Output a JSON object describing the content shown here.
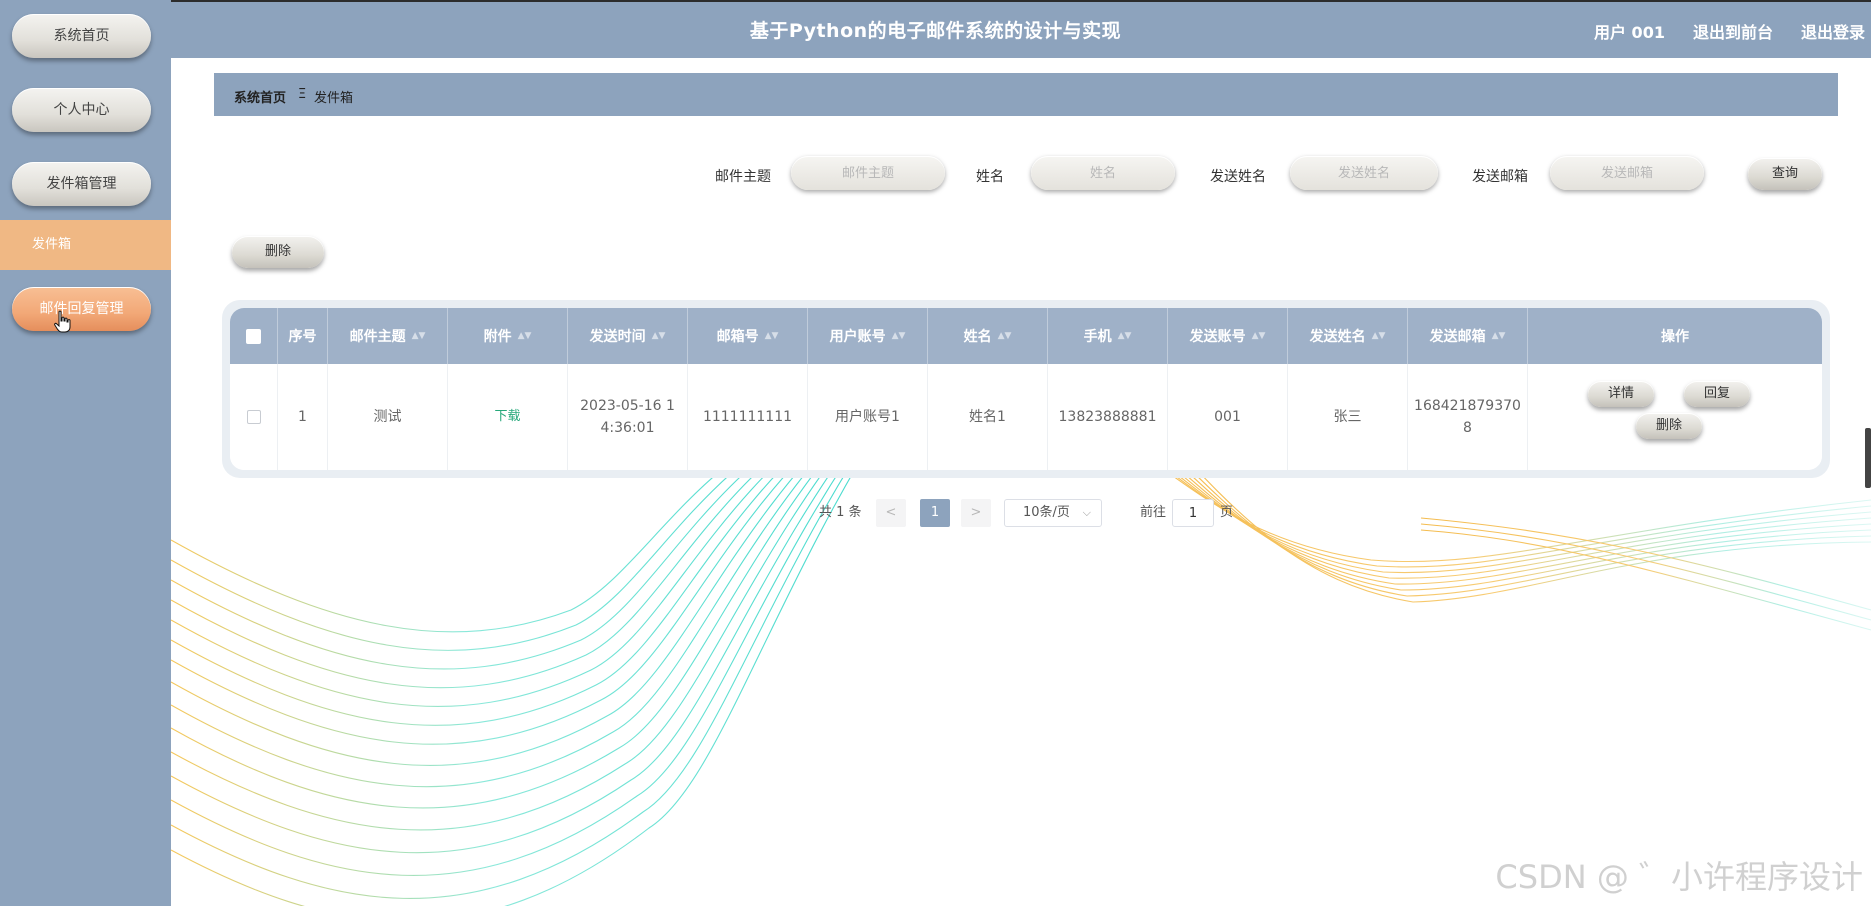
{
  "header": {
    "title": "基于Python的电子邮件系统的设计与实现",
    "user": "用户 001",
    "exit_front": "退出到前台",
    "logout": "退出登录"
  },
  "sidebar": {
    "items": [
      {
        "label": "系统首页"
      },
      {
        "label": "个人中心"
      },
      {
        "label": "发件箱管理"
      },
      {
        "label": "发件箱"
      },
      {
        "label": "邮件回复管理"
      }
    ]
  },
  "breadcrumb": {
    "home": "系统首页",
    "separator": "Ξ",
    "current": "发件箱"
  },
  "search": {
    "subject_label": "邮件主题",
    "subject_placeholder": "邮件主题",
    "name_label": "姓名",
    "name_placeholder": "姓名",
    "sender_name_label": "发送姓名",
    "sender_name_placeholder": "发送姓名",
    "sender_email_label": "发送邮箱",
    "sender_email_placeholder": "发送邮箱",
    "query_button": "查询"
  },
  "toolbar": {
    "delete_button": "删除"
  },
  "table": {
    "columns": [
      "序号",
      "邮件主题",
      "附件",
      "发送时间",
      "邮箱号",
      "用户账号",
      "姓名",
      "手机",
      "发送账号",
      "发送姓名",
      "发送邮箱",
      "操作"
    ],
    "rows": [
      {
        "index": "1",
        "subject": "测试",
        "attachment": "下载",
        "send_time_line1": "2023-05-16 1",
        "send_time_line2": "4:36:01",
        "email_no": "1111111111",
        "user_account": "用户账号1",
        "name": "姓名1",
        "phone": "13823888881",
        "sender_account": "001",
        "sender_name": "张三",
        "sender_email_line1": "168421879370",
        "sender_email_line2": "8",
        "actions": {
          "detail": "详情",
          "reply": "回复",
          "delete": "删除"
        }
      }
    ]
  },
  "pagination": {
    "total": "共 1 条",
    "prev": "<",
    "page": "1",
    "next": ">",
    "page_size": "10条/页",
    "goto_label": "前往",
    "goto_value": "1",
    "page_suffix": "页"
  },
  "watermark": "CSDN @ ゛小许程序设计",
  "colors": {
    "primary": "#8da3bd",
    "table_header": "#9fb1c8",
    "active_sub": "#f0b884",
    "orange_button": "#f2a877",
    "link_green": "#26a87a"
  }
}
